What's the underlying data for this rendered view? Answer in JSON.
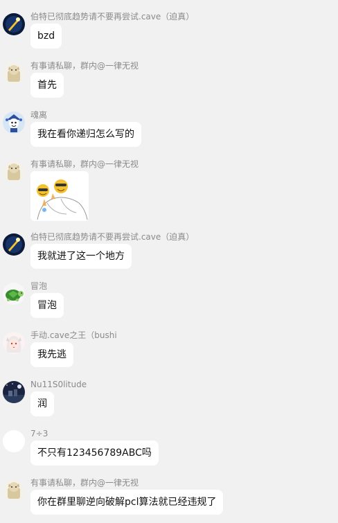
{
  "messages": [
    {
      "nickname": "伯特已彻底趋势请不要再尝试.cave（迫真）",
      "text": "bzd",
      "avatar": "comet-avatar-icon"
    },
    {
      "nickname": "有事请私聊，群内@一律无视",
      "text": "首先",
      "avatar": "cat-avatar-icon"
    },
    {
      "nickname": "魂离",
      "text": "我在看你递归怎么写的",
      "avatar": "jester-avatar-icon"
    },
    {
      "nickname": "有事请私聊，群内@一律无视",
      "sticker": "cheers-sticker-image",
      "avatar": "cat-avatar-icon"
    },
    {
      "nickname": "伯特已彻底趋势请不要再尝试.cave（迫真）",
      "text": "我就进了这一个地方",
      "avatar": "comet-avatar-icon"
    },
    {
      "nickname": "冒泡",
      "text": "冒泡",
      "avatar": "turtle-avatar-icon"
    },
    {
      "nickname": "手动.cave之王（bushi",
      "text": "我先逃",
      "avatar": "anime-girl-avatar-icon"
    },
    {
      "nickname": "Nu11S0litude",
      "text": "润",
      "avatar": "night-scene-avatar-icon"
    },
    {
      "nickname": "7÷3",
      "text": "不只有123456789ABC吗",
      "avatar": "blank-avatar-icon"
    },
    {
      "nickname": "有事请私聊，群内@一律无视",
      "text": "你在群里聊逆向破解pcl算法就已经违规了",
      "avatar": "cat-avatar-icon"
    }
  ]
}
